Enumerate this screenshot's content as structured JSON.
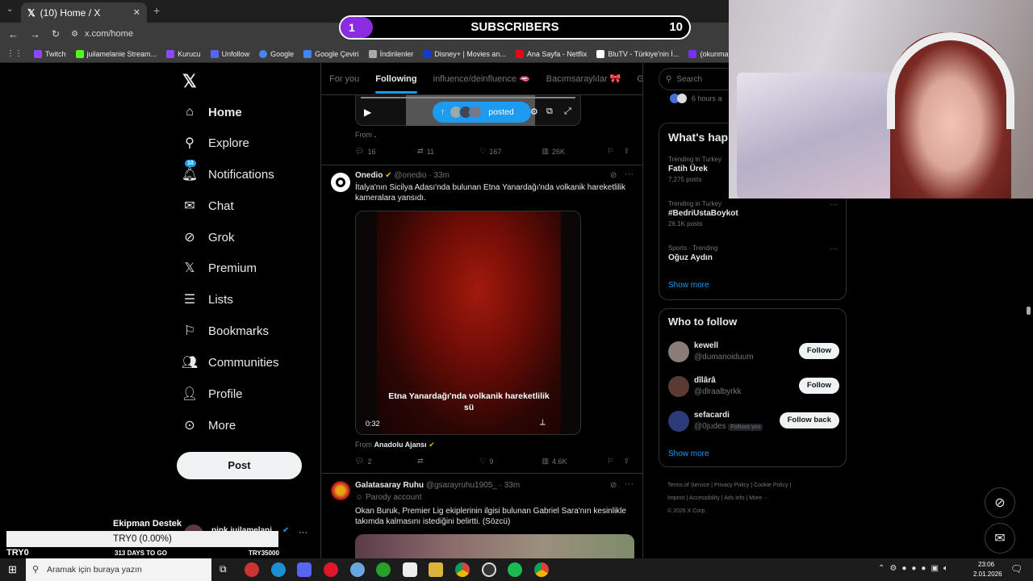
{
  "browser": {
    "tab_title": "(10) Home / X",
    "url": "x.com/home",
    "bookmarks": [
      "Twitch",
      "juilamelanie Stream...",
      "Kurucu",
      "Unfollow",
      "Google",
      "Google Çeviri",
      "İndirilenler",
      "Disney+ | Movies an...",
      "Ana Sayfa - Netflix",
      "BluTV - Türkiye'nin İ...",
      "(okunmamış sayısı)..."
    ]
  },
  "subscribers": {
    "current": "1",
    "title": "SUBSCRIBERS",
    "goal": "10"
  },
  "nav": {
    "items": [
      "Home",
      "Explore",
      "Notifications",
      "Chat",
      "Grok",
      "Premium",
      "Lists",
      "Bookmarks",
      "Communities",
      "Profile",
      "More"
    ],
    "notification_count": "10",
    "post_label": "Post"
  },
  "feed": {
    "tabs": [
      "For you",
      "Following",
      "influence/deinfluence 🫦",
      "Bacımsaraylılar 🎀",
      "Gala"
    ],
    "posted_pill": "posted",
    "from_label": "From",
    "post0_actions": {
      "replies": "16",
      "reposts": "11",
      "likes": "167",
      "views": "26K"
    },
    "post1": {
      "name": "Onedio",
      "handle": "@onedio",
      "time": "33m",
      "text": "İtalya'nın Sicilya Adası'nda bulunan Etna Yanardağı'nda volkanik hareketlilik kameralara yansıdı.",
      "video_caption": "Etna Yanardağı'nda volkanik hareketlilik sü",
      "duration": "0:32",
      "source_prefix": "From",
      "source": "Anadolu Ajansı",
      "actions": {
        "replies": "2",
        "reposts": "",
        "likes": "9",
        "views": "4.6K"
      }
    },
    "post2": {
      "name": "Galatasaray Ruhu",
      "handle": "@gsarayruhu1905_",
      "time": "33m",
      "badge": "Parody account",
      "text": "Okan Buruk, Premier Lig ekiplerinin ilgisi bulunan Gabriel Sara'nın kesinlikle takımda kalmasını istediğini belirtti. (Sözcü)"
    }
  },
  "sidebar": {
    "search_placeholder": "Search",
    "top_time": "6 hours a",
    "whats_happening": "What's happ",
    "trends": [
      {
        "meta": "Trending in Turkey",
        "name": "Fatih Ürek",
        "count": "7,275 posts"
      },
      {
        "meta": "Trending in Turkey",
        "name": "#BedriUstaBoykot",
        "count": "26.1K posts"
      },
      {
        "meta": "Sports · Trending",
        "name": "Oğuz Aydın",
        "count": ""
      }
    ],
    "show_more": "Show more",
    "who_to_follow": "Who to follow",
    "follow": [
      {
        "name": "kewell",
        "handle": "@dumanoiduum",
        "button": "Follow",
        "tag": ""
      },
      {
        "name": "dîlârâ",
        "handle": "@dlraalbyrkk",
        "button": "Follow",
        "tag": ""
      },
      {
        "name": "sefacardi",
        "handle": "@0judes",
        "button": "Follow back",
        "tag": "Follows you"
      }
    ],
    "footer": [
      "Terms of Service",
      "Privacy Policy",
      "Cookie Policy",
      "Imprint",
      "Accessibility",
      "Ads info",
      "More ···",
      "© 2026 X Corp."
    ]
  },
  "overlay": {
    "ekipman": "Ekipman Destek",
    "try_value": "TRY0 (0.00%)",
    "try_left": "TRY0",
    "days": "313 DAYS TO GO",
    "try_right": "TRY35000",
    "account_name": "pink juilamelani"
  },
  "taskbar": {
    "search_placeholder": "Aramak için buraya yazın",
    "time": "23:06",
    "date": "2.01.2026"
  }
}
